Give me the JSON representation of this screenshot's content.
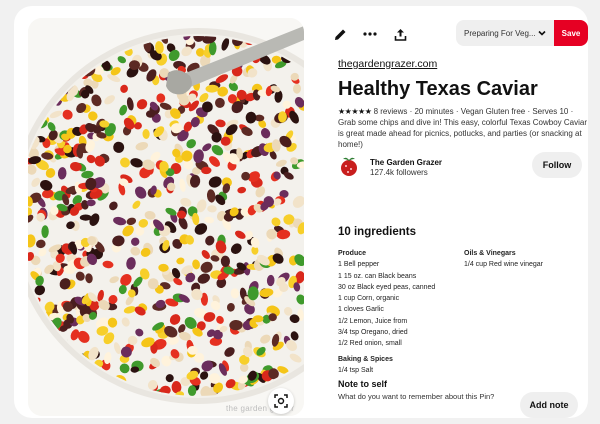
{
  "toolbar": {
    "edit_icon": "pencil-icon",
    "more_icon": "more-horizontal-icon",
    "share_icon": "share-upload-icon",
    "board_select": "Preparing For Veg...",
    "save_label": "Save"
  },
  "pin": {
    "source": "thegardengrazer.com",
    "title": "Healthy Texas Caviar",
    "stars": "★★★★★",
    "meta": " 8 reviews · 20 minutes · Vegan Gluten free · Serves 10 · Grab some chips and dive in! This easy, colorful Texas Cowboy Caviar is great made ahead for picnics, potlucks, and parties (or snacking at home!)",
    "watermark": "the garden grazer"
  },
  "creator": {
    "name": "The Garden Grazer",
    "followers": "127.4k followers",
    "follow_label": "Follow"
  },
  "ingredients": {
    "title": "10 ingredients",
    "produce_label": "Produce",
    "produce": [
      "1 Bell pepper",
      "1 15 oz. can Black beans",
      "30 oz Black eyed peas, canned",
      "1 cup Corn, organic",
      "1 cloves Garlic",
      "1/2 Lemon, Juice from",
      "3/4 tsp Oregano, dried",
      "1/2 Red onion, small"
    ],
    "baking_label": "Baking & Spices",
    "baking": [
      "1/4 tsp Salt"
    ],
    "oils_label": "Oils & Vinegars",
    "oils": [
      "1/4 cup Red wine vinegar"
    ]
  },
  "note": {
    "title": "Note to self",
    "text": "What do you want to remember about this Pin?",
    "add_label": "Add note"
  },
  "colors": {
    "save_red": "#e60023",
    "button_gray": "#efefef"
  }
}
